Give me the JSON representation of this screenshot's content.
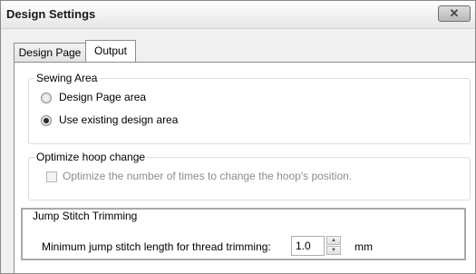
{
  "window": {
    "title": "Design Settings",
    "close_glyph": "✕"
  },
  "tabs": [
    {
      "label": "Design Page",
      "active": false
    },
    {
      "label": "Output",
      "active": true
    }
  ],
  "sewing_area": {
    "title": "Sewing Area",
    "options": [
      {
        "label": "Design Page area",
        "checked": false
      },
      {
        "label": "Use existing design area",
        "checked": true
      }
    ]
  },
  "optimize_hoop": {
    "title": "Optimize hoop change",
    "checkbox_label": "Optimize the number of times to change the hoop's position.",
    "checked": false,
    "enabled": false
  },
  "jump_stitch": {
    "title": "Jump Stitch Trimming",
    "field_label": "Minimum jump stitch length for thread trimming:",
    "value": "1.0",
    "unit": "mm"
  }
}
